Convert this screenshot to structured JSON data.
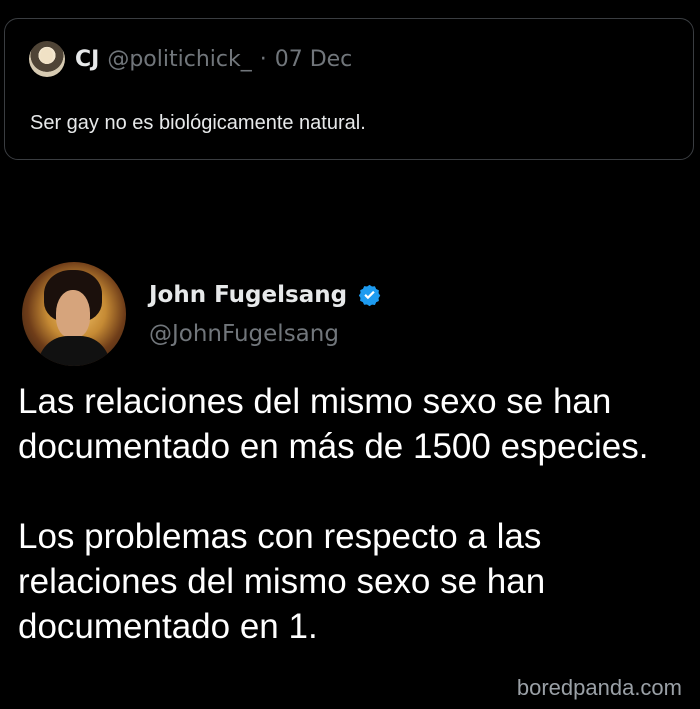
{
  "quoted_post": {
    "author_name": "CJ",
    "author_handle": "@politichick_",
    "separator": "·",
    "date": "07 Dec",
    "text": "Ser gay no es biológicamente natural."
  },
  "main_post": {
    "author_name": "John Fugelsang",
    "author_handle": "@JohnFugelsang",
    "verified_color": "#1d9bf0",
    "paragraph_1_line_1": "Las relaciones del mismo sexo se han",
    "paragraph_1_line_2": "documentado en más de 1500 especies.",
    "paragraph_2_line_1": "Los problemas con respecto a las",
    "paragraph_2_line_2": "relaciones del mismo sexo se han",
    "paragraph_2_line_3": "documentado en 1."
  },
  "watermark": {
    "text": "boredpanda.com"
  },
  "icons": {
    "quoted_avatar": "user-avatar-icon",
    "main_avatar": "profile-photo",
    "verified": "verified-badge-icon"
  }
}
